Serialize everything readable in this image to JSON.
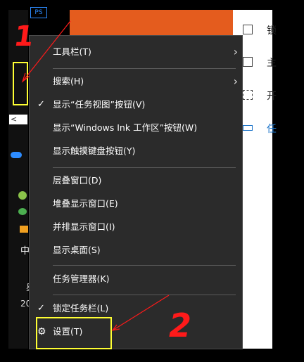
{
  "menu": {
    "items": [
      {
        "label": "工具栏(T)",
        "submenu": true,
        "checked": false
      },
      {
        "label": "搜索(H)",
        "submenu": true,
        "checked": false
      },
      {
        "label": "显示“任务视图”按钮(V)",
        "submenu": false,
        "checked": true
      },
      {
        "label": "显示“Windows Ink 工作区”按钮(W)",
        "submenu": false,
        "checked": false
      },
      {
        "label": "显示触摸键盘按钮(Y)",
        "submenu": false,
        "checked": false
      },
      {
        "label": "层叠窗口(D)",
        "submenu": false,
        "checked": false
      },
      {
        "label": "堆叠显示窗口(E)",
        "submenu": false,
        "checked": false
      },
      {
        "label": "并排显示窗口(I)",
        "submenu": false,
        "checked": false
      },
      {
        "label": "显示桌面(S)",
        "submenu": false,
        "checked": false
      },
      {
        "label": "任务管理器(K)",
        "submenu": false,
        "checked": false
      },
      {
        "label": "锁定任务栏(L)",
        "submenu": false,
        "checked": true
      },
      {
        "label": "设置(T)",
        "submenu": false,
        "checked": false,
        "icon": "gear-icon"
      }
    ]
  },
  "right_panel": {
    "rows": [
      {
        "text": "锁",
        "icon": "lock-screen-icon"
      },
      {
        "text": "主",
        "icon": "theme-icon"
      },
      {
        "text": "开",
        "icon": "start-icon"
      },
      {
        "text": "任",
        "icon": "taskbar-icon"
      }
    ]
  },
  "left_strip": {
    "ps_label": "PS",
    "back_arrow": "<",
    "char_zhong": "中",
    "char_20": "20",
    "char_xing": "星"
  },
  "annotations": {
    "marker_1": "1",
    "marker_2": "2"
  },
  "colors": {
    "menu_bg": "#2b2b2b",
    "annotation_box": "#ffff33",
    "annotation_red": "#ff1a1a",
    "desktop_orange": "#e45c1e"
  }
}
